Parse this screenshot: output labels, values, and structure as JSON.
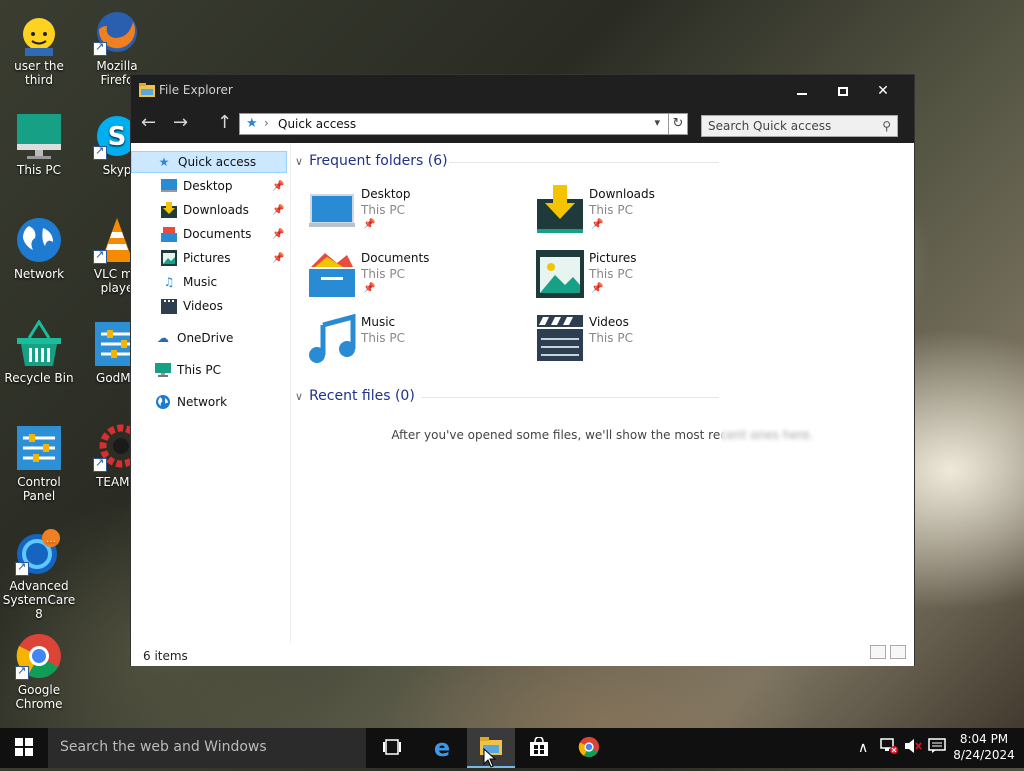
{
  "desktop": {
    "icons": [
      {
        "label": "user the third"
      },
      {
        "label": "Mozilla Firefox",
        "display": "Mozilla\nFirefo"
      },
      {
        "label": "This PC"
      },
      {
        "label": "Skype",
        "display": "Skyp"
      },
      {
        "label": "Network"
      },
      {
        "label": "VLC media player",
        "display": "VLC me\nplaye"
      },
      {
        "label": "Recycle Bin"
      },
      {
        "label": "GodMode",
        "display": "GodMo"
      },
      {
        "label": "Control Panel"
      },
      {
        "label": "TEAMCENTER",
        "display": "TEAMC"
      },
      {
        "label": "Advanced SystemCare 8",
        "display": "Advanced\nSystemCare 8"
      },
      {
        "label": "Google Chrome",
        "display": "Google\nChrome"
      }
    ]
  },
  "window": {
    "title": "File Explorer",
    "address": {
      "path": "Quick access"
    },
    "search": {
      "placeholder": "Search Quick access"
    },
    "sidebar": {
      "quick_access": "Quick access",
      "items": [
        {
          "label": "Desktop",
          "pinned": true
        },
        {
          "label": "Downloads",
          "pinned": true
        },
        {
          "label": "Documents",
          "pinned": true
        },
        {
          "label": "Pictures",
          "pinned": true
        },
        {
          "label": "Music",
          "pinned": false
        },
        {
          "label": "Videos",
          "pinned": false
        }
      ],
      "onedrive": "OneDrive",
      "this_pc": "This PC",
      "network": "Network"
    },
    "frequent": {
      "header": "Frequent folders (6)",
      "folders": [
        {
          "name": "Desktop",
          "location": "This PC",
          "pinned": true
        },
        {
          "name": "Downloads",
          "location": "This PC",
          "pinned": true
        },
        {
          "name": "Documents",
          "location": "This PC",
          "pinned": true
        },
        {
          "name": "Pictures",
          "location": "This PC",
          "pinned": true
        },
        {
          "name": "Music",
          "location": "This PC",
          "pinned": false
        },
        {
          "name": "Videos",
          "location": "This PC",
          "pinned": false
        }
      ]
    },
    "recent": {
      "header": "Recent files (0)",
      "empty_message": "After you've opened some files, we'll show the most recent ones here."
    },
    "status": "6 items"
  },
  "taskbar": {
    "search_placeholder": "Search the web and Windows",
    "time": "8:04 PM",
    "date": "8/24/2024"
  },
  "colors": {
    "accent": "#2e84d6",
    "selection": "#cce8ff",
    "section_header": "#1e3287",
    "taskbar": "#101010"
  }
}
